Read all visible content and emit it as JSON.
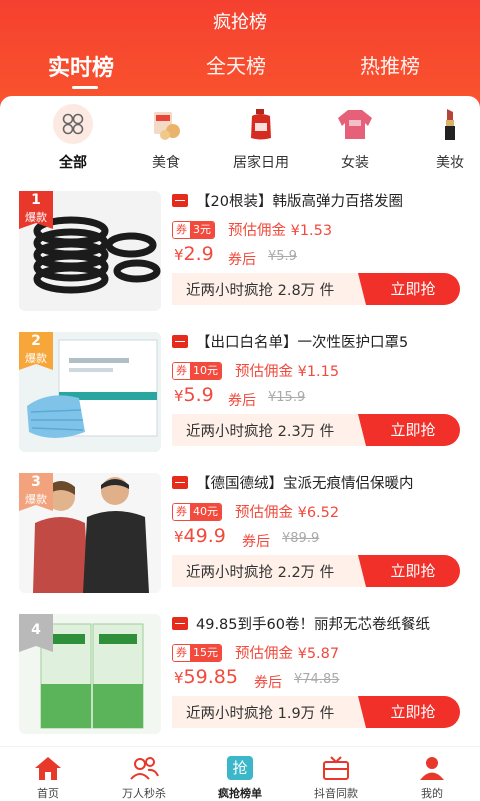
{
  "header": {
    "title": "疯抢榜"
  },
  "tabs": [
    {
      "label": "实时榜",
      "active": true
    },
    {
      "label": "全天榜",
      "active": false
    },
    {
      "label": "热推榜",
      "active": false
    }
  ],
  "categories": [
    {
      "label": "全部",
      "icon": "grid-icon",
      "active": true
    },
    {
      "label": "美食",
      "icon": "food-icon",
      "active": false
    },
    {
      "label": "居家日用",
      "icon": "detergent-icon",
      "active": false
    },
    {
      "label": "女装",
      "icon": "sweater-icon",
      "active": false
    },
    {
      "label": "美妆",
      "icon": "lipstick-icon",
      "active": false
    }
  ],
  "products": [
    {
      "rank": "1",
      "rank_tag": "爆款",
      "name": "【20根装】韩版高弹力百搭发圈",
      "coupon_label": "券",
      "coupon_value": "3元",
      "commission_label": "预估佣金",
      "commission": "¥1.53",
      "price_symbol": "¥",
      "price": "2.9",
      "after_label": "券后",
      "original_price": "¥5.9",
      "sold_text": "近两小时疯抢 2.8万 件",
      "buy_label": "立即抢"
    },
    {
      "rank": "2",
      "rank_tag": "爆款",
      "name": "【出口白名单】一次性医护口罩5",
      "coupon_label": "券",
      "coupon_value": "10元",
      "commission_label": "预估佣金",
      "commission": "¥1.15",
      "price_symbol": "¥",
      "price": "5.9",
      "after_label": "券后",
      "original_price": "¥15.9",
      "sold_text": "近两小时疯抢 2.3万 件",
      "buy_label": "立即抢"
    },
    {
      "rank": "3",
      "rank_tag": "爆款",
      "name": "【德国德绒】宝派无痕情侣保暖内",
      "coupon_label": "券",
      "coupon_value": "40元",
      "commission_label": "预估佣金",
      "commission": "¥6.52",
      "price_symbol": "¥",
      "price": "49.9",
      "after_label": "券后",
      "original_price": "¥89.9",
      "sold_text": "近两小时疯抢 2.2万 件",
      "buy_label": "立即抢"
    },
    {
      "rank": "4",
      "rank_tag": "",
      "name": "49.85到手60卷！丽邦无芯卷纸餐纸",
      "coupon_label": "券",
      "coupon_value": "15元",
      "commission_label": "预估佣金",
      "commission": "¥5.87",
      "price_symbol": "¥",
      "price": "59.85",
      "after_label": "券后",
      "original_price": "¥74.85",
      "sold_text": "近两小时疯抢 1.9万 件",
      "buy_label": "立即抢"
    }
  ],
  "bottom_nav": [
    {
      "label": "首页",
      "icon": "home-icon",
      "active": false
    },
    {
      "label": "万人秒杀",
      "icon": "people-icon",
      "active": false
    },
    {
      "label": "疯抢榜单",
      "icon": "grab-icon",
      "icon_text": "抢",
      "active": true
    },
    {
      "label": "抖音同款",
      "icon": "tv-icon",
      "active": false
    },
    {
      "label": "我的",
      "icon": "user-icon",
      "active": false
    }
  ],
  "colors": {
    "brand": "#f5402f",
    "accent": "#f24a3c",
    "coupon_bg": "#fff1ea"
  }
}
